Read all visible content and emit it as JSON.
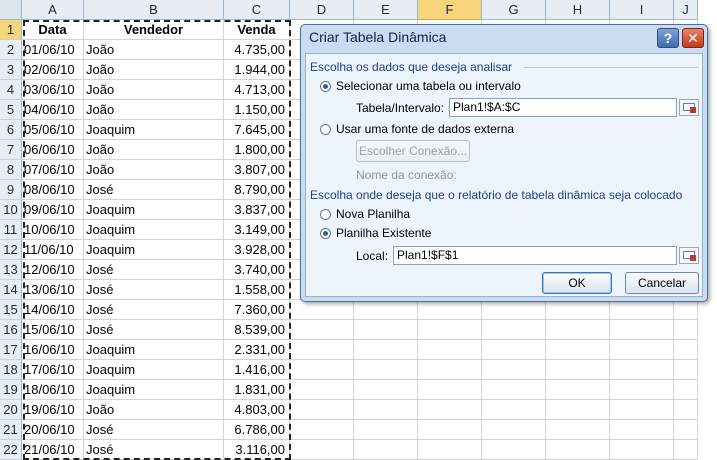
{
  "sheet": {
    "columns": [
      "A",
      "B",
      "C",
      "D",
      "E",
      "F",
      "G",
      "H",
      "I",
      "J"
    ],
    "header_row": [
      "Data",
      "Vendedor",
      "Venda"
    ],
    "rows": [
      {
        "n": "2",
        "date": "01/06/10",
        "vendor": "João",
        "sale": "4.735,00"
      },
      {
        "n": "3",
        "date": "02/06/10",
        "vendor": "João",
        "sale": "1.944,00"
      },
      {
        "n": "4",
        "date": "03/06/10",
        "vendor": "João",
        "sale": "4.713,00"
      },
      {
        "n": "5",
        "date": "04/06/10",
        "vendor": "João",
        "sale": "1.150,00"
      },
      {
        "n": "6",
        "date": "05/06/10",
        "vendor": "Joaquim",
        "sale": "7.645,00"
      },
      {
        "n": "7",
        "date": "06/06/10",
        "vendor": "João",
        "sale": "1.800,00"
      },
      {
        "n": "8",
        "date": "07/06/10",
        "vendor": "João",
        "sale": "3.807,00"
      },
      {
        "n": "9",
        "date": "08/06/10",
        "vendor": "José",
        "sale": "8.790,00"
      },
      {
        "n": "10",
        "date": "09/06/10",
        "vendor": "Joaquim",
        "sale": "3.837,00"
      },
      {
        "n": "11",
        "date": "10/06/10",
        "vendor": "Joaquim",
        "sale": "3.149,00"
      },
      {
        "n": "12",
        "date": "11/06/10",
        "vendor": "Joaquim",
        "sale": "3.928,00"
      },
      {
        "n": "13",
        "date": "12/06/10",
        "vendor": "José",
        "sale": "3.740,00"
      },
      {
        "n": "14",
        "date": "13/06/10",
        "vendor": "José",
        "sale": "1.558,00"
      },
      {
        "n": "15",
        "date": "14/06/10",
        "vendor": "José",
        "sale": "7.360,00"
      },
      {
        "n": "16",
        "date": "15/06/10",
        "vendor": "José",
        "sale": "8.539,00"
      },
      {
        "n": "17",
        "date": "16/06/10",
        "vendor": "Joaquim",
        "sale": "2.331,00"
      },
      {
        "n": "18",
        "date": "17/06/10",
        "vendor": "Joaquim",
        "sale": "1.416,00"
      },
      {
        "n": "19",
        "date": "18/06/10",
        "vendor": "Joaquim",
        "sale": "1.831,00"
      },
      {
        "n": "20",
        "date": "19/06/10",
        "vendor": "João",
        "sale": "4.803,00"
      },
      {
        "n": "21",
        "date": "20/06/10",
        "vendor": "José",
        "sale": "6.786,00"
      },
      {
        "n": "22",
        "date": "21/06/10",
        "vendor": "José",
        "sale": "3.116,00"
      }
    ],
    "first_row_number": "1",
    "selected_column": "F",
    "selected_row": "1"
  },
  "dialog": {
    "title": "Criar Tabela Dinâmica",
    "help_label": "?",
    "close_label": "✕",
    "section_data": "Escolha os dados que deseja analisar",
    "opt_select_table": "Selecionar uma tabela ou intervalo",
    "table_range_label": "Tabela/Intervalo:",
    "table_range_value": "Plan1!$A:$C",
    "opt_external": "Usar uma fonte de dados externa",
    "choose_connection": "Escolher Conexão...",
    "connection_name_label": "Nome da conexão:",
    "section_location": "Escolha onde deseja que o relatório de tabela dinâmica seja colocado",
    "opt_new_sheet": "Nova Planilha",
    "opt_existing_sheet": "Planilha Existente",
    "location_label": "Local:",
    "location_value": "Plan1!$F$1",
    "ok_label": "OK",
    "cancel_label": "Cancelar",
    "selected_data_option": "table",
    "selected_location_option": "existing"
  },
  "colors": {
    "selection_header": "#f7d57a",
    "dialog_frame": "#c9dcf2",
    "section_text": "#1b3f8a"
  }
}
